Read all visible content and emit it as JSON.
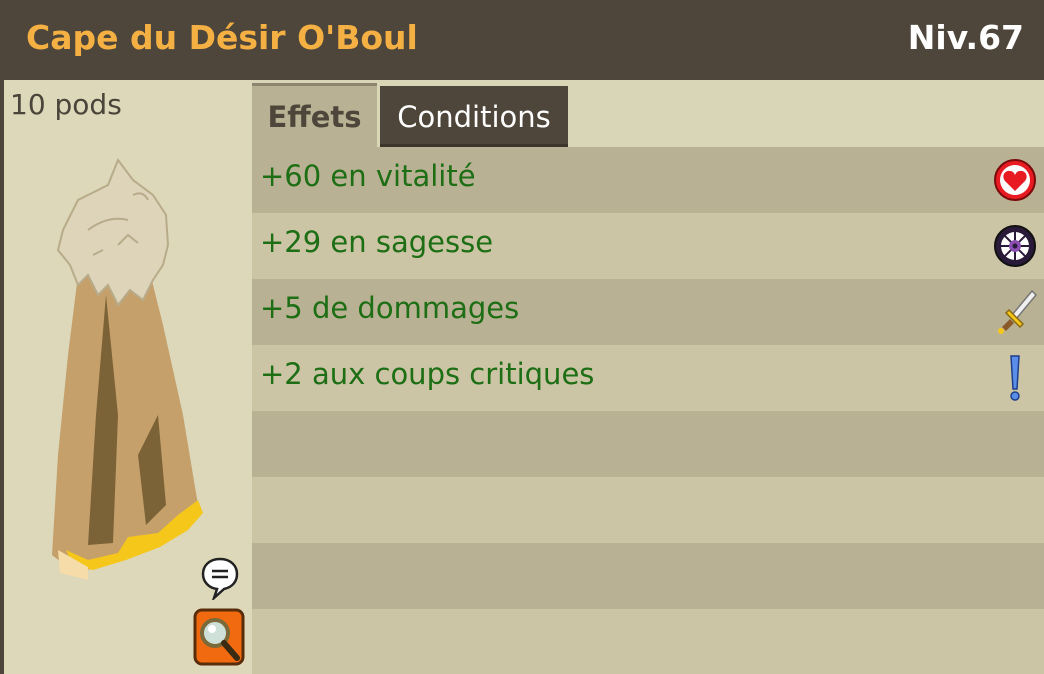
{
  "item": {
    "name": "Cape du Désir O'Boul",
    "level": "Niv.67",
    "weight": "10 pods"
  },
  "tabs": [
    {
      "label": "Effets",
      "active": true
    },
    {
      "label": "Conditions",
      "active": false
    }
  ],
  "effects": [
    {
      "text": "+60 en vitalité",
      "icon": "heart-icon"
    },
    {
      "text": "+29 en sagesse",
      "icon": "wisdom-icon"
    },
    {
      "text": "+5 de dommages",
      "icon": "sword-icon"
    },
    {
      "text": "+2 aux coups critiques",
      "icon": "exclamation-icon"
    }
  ],
  "colors": {
    "header_bg": "#4e463a",
    "title": "#f5b043",
    "effect_text": "#1d6e14"
  }
}
